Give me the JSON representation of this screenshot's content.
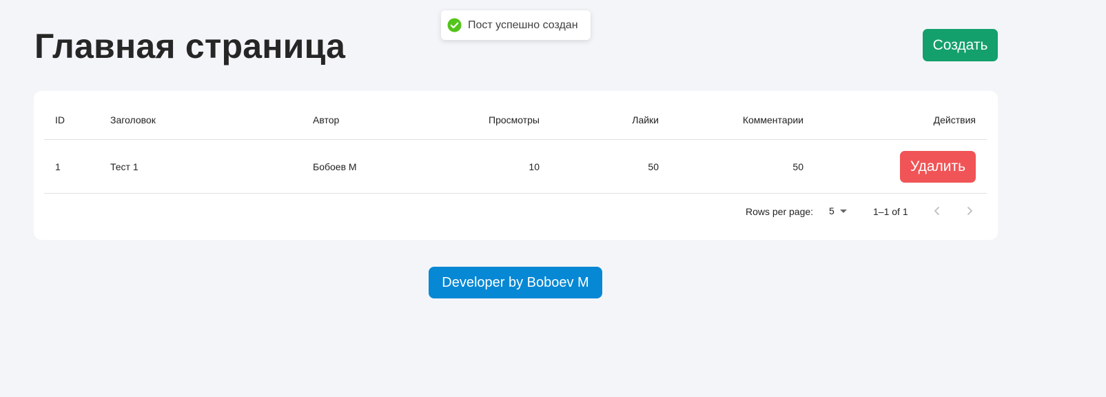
{
  "header": {
    "title": "Главная страница",
    "create_label": "Создать"
  },
  "toast": {
    "message": "Пост успешно создан",
    "icon": "check-circle-icon",
    "color": "#52c41a"
  },
  "table": {
    "columns": {
      "id": "ID",
      "title": "Заголовок",
      "author": "Автор",
      "views": "Просмотры",
      "likes": "Лайки",
      "comments": "Комментарии",
      "actions": "Действия"
    },
    "rows": [
      {
        "id": "1",
        "title": "Тест 1",
        "author": "Бобоев М",
        "views": "10",
        "likes": "50",
        "comments": "50",
        "delete_label": "Удалить"
      }
    ]
  },
  "pagination": {
    "rows_per_page_label": "Rows per page:",
    "rows_per_page": "5",
    "range": "1–1 of 1",
    "prev_icon": "chevron-left-icon",
    "next_icon": "chevron-right-icon"
  },
  "footer": {
    "developer_label": "Developer by Boboev M"
  },
  "colors": {
    "background": "#f4f5f9",
    "create_button": "#13a06c",
    "delete_button": "#f05456",
    "developer_button": "#0688d4"
  }
}
